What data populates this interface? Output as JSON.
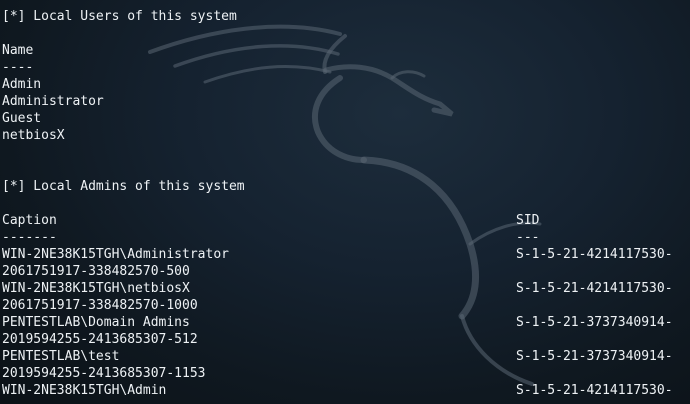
{
  "terminal": {
    "section_users": {
      "header": "[*] Local Users of this system",
      "column_header": "Name",
      "underline": "----",
      "users": [
        "Admin",
        "Administrator",
        "Guest",
        "netbiosX"
      ]
    },
    "section_admins": {
      "header": "[*] Local Admins of this system",
      "caption_header": "Caption",
      "sid_header": "SID",
      "caption_underline": "-------",
      "sid_underline": "---",
      "entries": [
        {
          "caption": "WIN-2NE38K15TGH\\Administrator",
          "sid": "S-1-5-21-4214117530-",
          "continuation": "2061751917-338482570-500"
        },
        {
          "caption": "WIN-2NE38K15TGH\\netbiosX",
          "sid": "S-1-5-21-4214117530-",
          "continuation": "2061751917-338482570-1000"
        },
        {
          "caption": "PENTESTLAB\\Domain Admins",
          "sid": "S-1-5-21-3737340914-",
          "continuation": "2019594255-2413685307-512"
        },
        {
          "caption": "PENTESTLAB\\test",
          "sid": "S-1-5-21-3737340914-",
          "continuation": "2019594255-2413685307-1153"
        },
        {
          "caption": "WIN-2NE38K15TGH\\Admin",
          "sid": "S-1-5-21-4214117530-"
        }
      ]
    }
  },
  "icons": {
    "wallpaper": "kali-dragon-icon"
  },
  "colors": {
    "background": "#152230",
    "text": "#eef2f5",
    "dragon": "#5a6672"
  }
}
